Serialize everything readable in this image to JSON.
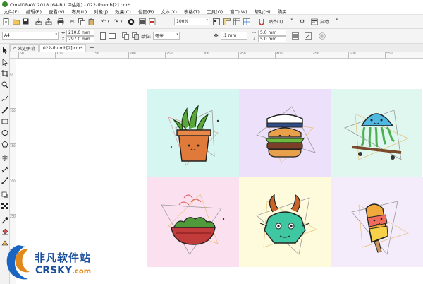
{
  "window": {
    "title": "CorelDRAW 2018 (64-Bit 评估版) - 022-thumb[2].cdr*"
  },
  "menu": [
    "文件(F)",
    "编辑(E)",
    "查看(V)",
    "布局(L)",
    "对象(J)",
    "效果(C)",
    "位图(B)",
    "文本(X)",
    "表格(T)",
    "工具(O)",
    "窗口(W)",
    "帮助(H)",
    "购买"
  ],
  "toolbar1": {
    "zoom": "100%",
    "snap_label": "贴齐(T)",
    "launch_label": "启动"
  },
  "toolbar2": {
    "page_size": "A4",
    "width": "210.0 mm",
    "height": "297.0 mm",
    "units_label": "单位:",
    "units_value": "毫米",
    "nudge": ".1 mm",
    "dup_x": "5.0 mm",
    "dup_y": "5.0 mm"
  },
  "tabs": [
    {
      "label": "欢迎屏幕"
    },
    {
      "label": "022-thumb[2].cdr*"
    }
  ],
  "ruler": {
    "h_ticks": [
      "50",
      "100",
      "150",
      "200",
      "250",
      "300",
      "350",
      "400",
      "450",
      "500",
      "550"
    ],
    "v_ticks": [
      "50",
      "100",
      "150",
      "200",
      "250",
      "300"
    ]
  },
  "artwork": {
    "colors": {
      "mint": "#d6f6f1",
      "lavender": "#ece0fa",
      "mint2": "#dff7ef",
      "pink": "#fbe1f0",
      "cream": "#fdfbdb",
      "lilac": "#f4ecfb"
    },
    "icons": [
      "potted-plant-icon",
      "burger-chef-icon",
      "jellyfish-skateboard-icon",
      "bowl-dish-icon",
      "monster-goat-icon",
      "popsicle-icon"
    ]
  },
  "watermark": {
    "cn": "非凡软件站",
    "en_main": "CRSKY",
    "en_suffix": ".com"
  }
}
